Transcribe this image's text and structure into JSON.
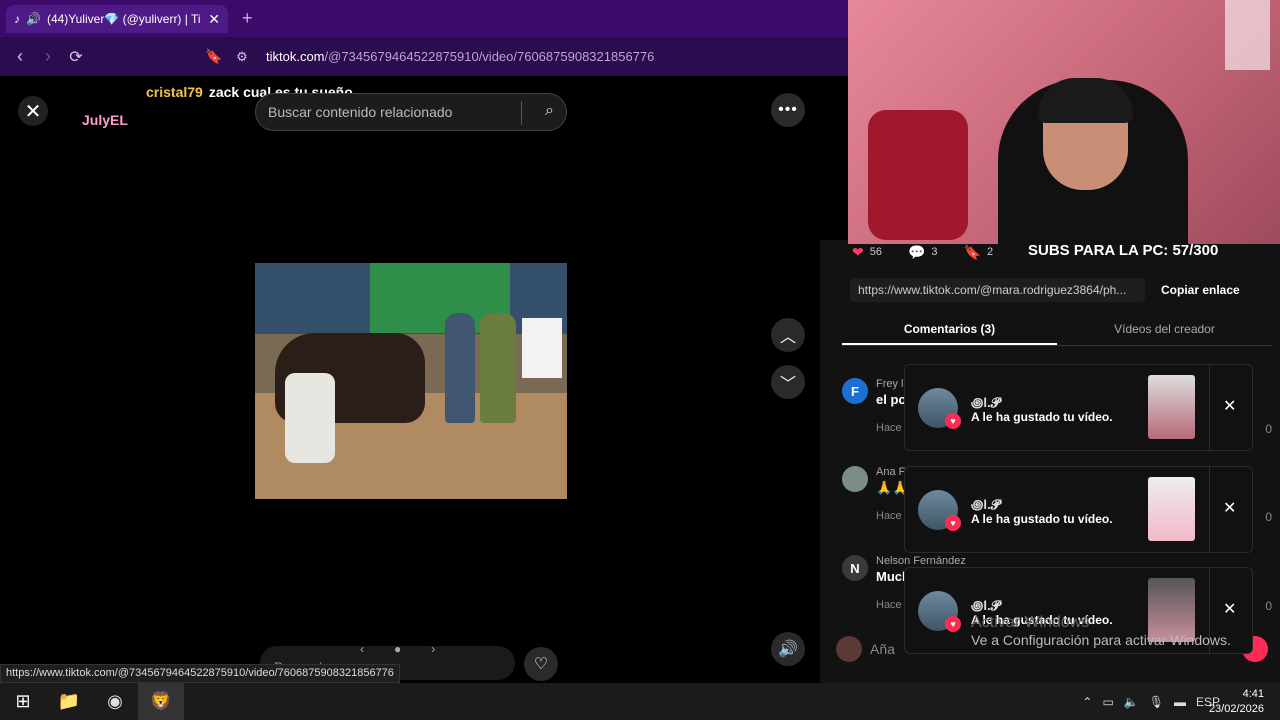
{
  "browser": {
    "tab_title": "(44)Yuliver💎 (@yuliverr) | Ti",
    "tab_close": "✕",
    "new_tab": "+",
    "url_domain": "tiktok.com",
    "url_path": "/@7345679464522875910/video/7606875908321856776",
    "status_url": "https://www.tiktok.com/@7345679464522875910/video/7606875908321856776"
  },
  "video": {
    "chat_user": "cristal79",
    "chat_text": "zack cual es tu sueño",
    "badge_user": "JulyEL",
    "search_placeholder": "Buscar contenido relacionado",
    "reply_label": "Responder"
  },
  "panel": {
    "likes": "56",
    "comments": "3",
    "saves": "2",
    "subs_text": "SUBS PARA LA PC: 57/300",
    "share_link": "https://www.tiktok.com/@mara.rodriguez3864/ph...",
    "copy_label": "Copiar enlace",
    "tab_comments": "Comentarios (3)",
    "tab_creator": "Vídeos del creador",
    "comments_list": [
      {
        "initial": "F",
        "name": "Frey l",
        "text": "el po",
        "meta": "Hace",
        "count": "0",
        "color": "#1d6fd1"
      },
      {
        "initial": "",
        "name": "Ana F",
        "text": "🙏🙏",
        "meta": "Hace",
        "count": "0",
        "color": "#7c8d86"
      },
      {
        "initial": "N",
        "name": "Nelson Fernández",
        "text": "Mucl",
        "meta": "Hace",
        "count": "0",
        "color": "#3a3a3a"
      }
    ],
    "add_comment_placeholder": "Aña"
  },
  "notifications": [
    {
      "name": "꩜l.𝓟",
      "message": "A le ha gustado tu vídeo."
    },
    {
      "name": "꩜l.𝓟",
      "message": "A le ha gustado tu vídeo."
    },
    {
      "name": "꩜l.𝓟",
      "message": "A le ha gustado tu vídeo."
    }
  ],
  "activate": {
    "title": "Activar Windows",
    "subtitle": "Ve a Configuración para activar Windows."
  },
  "taskbar": {
    "lang": "ESP",
    "time": "4:41",
    "date": "23/02/2026"
  }
}
